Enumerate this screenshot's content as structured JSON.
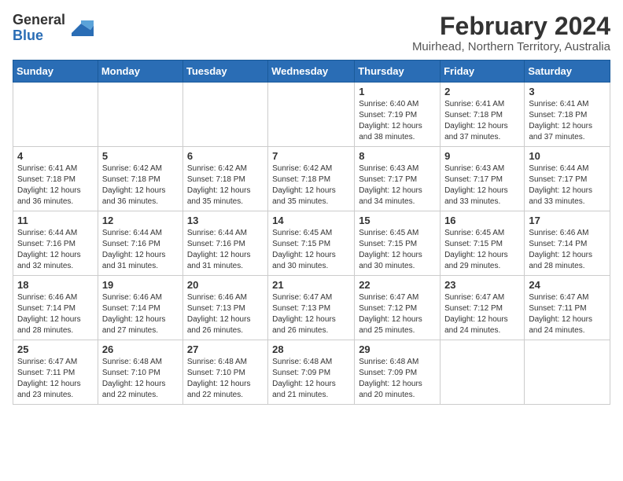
{
  "logo": {
    "general": "General",
    "blue": "Blue"
  },
  "title": "February 2024",
  "location": "Muirhead, Northern Territory, Australia",
  "weekdays": [
    "Sunday",
    "Monday",
    "Tuesday",
    "Wednesday",
    "Thursday",
    "Friday",
    "Saturday"
  ],
  "weeks": [
    [
      {
        "day": "",
        "info": ""
      },
      {
        "day": "",
        "info": ""
      },
      {
        "day": "",
        "info": ""
      },
      {
        "day": "",
        "info": ""
      },
      {
        "day": "1",
        "info": "Sunrise: 6:40 AM\nSunset: 7:19 PM\nDaylight: 12 hours\nand 38 minutes."
      },
      {
        "day": "2",
        "info": "Sunrise: 6:41 AM\nSunset: 7:18 PM\nDaylight: 12 hours\nand 37 minutes."
      },
      {
        "day": "3",
        "info": "Sunrise: 6:41 AM\nSunset: 7:18 PM\nDaylight: 12 hours\nand 37 minutes."
      }
    ],
    [
      {
        "day": "4",
        "info": "Sunrise: 6:41 AM\nSunset: 7:18 PM\nDaylight: 12 hours\nand 36 minutes."
      },
      {
        "day": "5",
        "info": "Sunrise: 6:42 AM\nSunset: 7:18 PM\nDaylight: 12 hours\nand 36 minutes."
      },
      {
        "day": "6",
        "info": "Sunrise: 6:42 AM\nSunset: 7:18 PM\nDaylight: 12 hours\nand 35 minutes."
      },
      {
        "day": "7",
        "info": "Sunrise: 6:42 AM\nSunset: 7:18 PM\nDaylight: 12 hours\nand 35 minutes."
      },
      {
        "day": "8",
        "info": "Sunrise: 6:43 AM\nSunset: 7:17 PM\nDaylight: 12 hours\nand 34 minutes."
      },
      {
        "day": "9",
        "info": "Sunrise: 6:43 AM\nSunset: 7:17 PM\nDaylight: 12 hours\nand 33 minutes."
      },
      {
        "day": "10",
        "info": "Sunrise: 6:44 AM\nSunset: 7:17 PM\nDaylight: 12 hours\nand 33 minutes."
      }
    ],
    [
      {
        "day": "11",
        "info": "Sunrise: 6:44 AM\nSunset: 7:16 PM\nDaylight: 12 hours\nand 32 minutes."
      },
      {
        "day": "12",
        "info": "Sunrise: 6:44 AM\nSunset: 7:16 PM\nDaylight: 12 hours\nand 31 minutes."
      },
      {
        "day": "13",
        "info": "Sunrise: 6:44 AM\nSunset: 7:16 PM\nDaylight: 12 hours\nand 31 minutes."
      },
      {
        "day": "14",
        "info": "Sunrise: 6:45 AM\nSunset: 7:15 PM\nDaylight: 12 hours\nand 30 minutes."
      },
      {
        "day": "15",
        "info": "Sunrise: 6:45 AM\nSunset: 7:15 PM\nDaylight: 12 hours\nand 30 minutes."
      },
      {
        "day": "16",
        "info": "Sunrise: 6:45 AM\nSunset: 7:15 PM\nDaylight: 12 hours\nand 29 minutes."
      },
      {
        "day": "17",
        "info": "Sunrise: 6:46 AM\nSunset: 7:14 PM\nDaylight: 12 hours\nand 28 minutes."
      }
    ],
    [
      {
        "day": "18",
        "info": "Sunrise: 6:46 AM\nSunset: 7:14 PM\nDaylight: 12 hours\nand 28 minutes."
      },
      {
        "day": "19",
        "info": "Sunrise: 6:46 AM\nSunset: 7:14 PM\nDaylight: 12 hours\nand 27 minutes."
      },
      {
        "day": "20",
        "info": "Sunrise: 6:46 AM\nSunset: 7:13 PM\nDaylight: 12 hours\nand 26 minutes."
      },
      {
        "day": "21",
        "info": "Sunrise: 6:47 AM\nSunset: 7:13 PM\nDaylight: 12 hours\nand 26 minutes."
      },
      {
        "day": "22",
        "info": "Sunrise: 6:47 AM\nSunset: 7:12 PM\nDaylight: 12 hours\nand 25 minutes."
      },
      {
        "day": "23",
        "info": "Sunrise: 6:47 AM\nSunset: 7:12 PM\nDaylight: 12 hours\nand 24 minutes."
      },
      {
        "day": "24",
        "info": "Sunrise: 6:47 AM\nSunset: 7:11 PM\nDaylight: 12 hours\nand 24 minutes."
      }
    ],
    [
      {
        "day": "25",
        "info": "Sunrise: 6:47 AM\nSunset: 7:11 PM\nDaylight: 12 hours\nand 23 minutes."
      },
      {
        "day": "26",
        "info": "Sunrise: 6:48 AM\nSunset: 7:10 PM\nDaylight: 12 hours\nand 22 minutes."
      },
      {
        "day": "27",
        "info": "Sunrise: 6:48 AM\nSunset: 7:10 PM\nDaylight: 12 hours\nand 22 minutes."
      },
      {
        "day": "28",
        "info": "Sunrise: 6:48 AM\nSunset: 7:09 PM\nDaylight: 12 hours\nand 21 minutes."
      },
      {
        "day": "29",
        "info": "Sunrise: 6:48 AM\nSunset: 7:09 PM\nDaylight: 12 hours\nand 20 minutes."
      },
      {
        "day": "",
        "info": ""
      },
      {
        "day": "",
        "info": ""
      }
    ]
  ]
}
